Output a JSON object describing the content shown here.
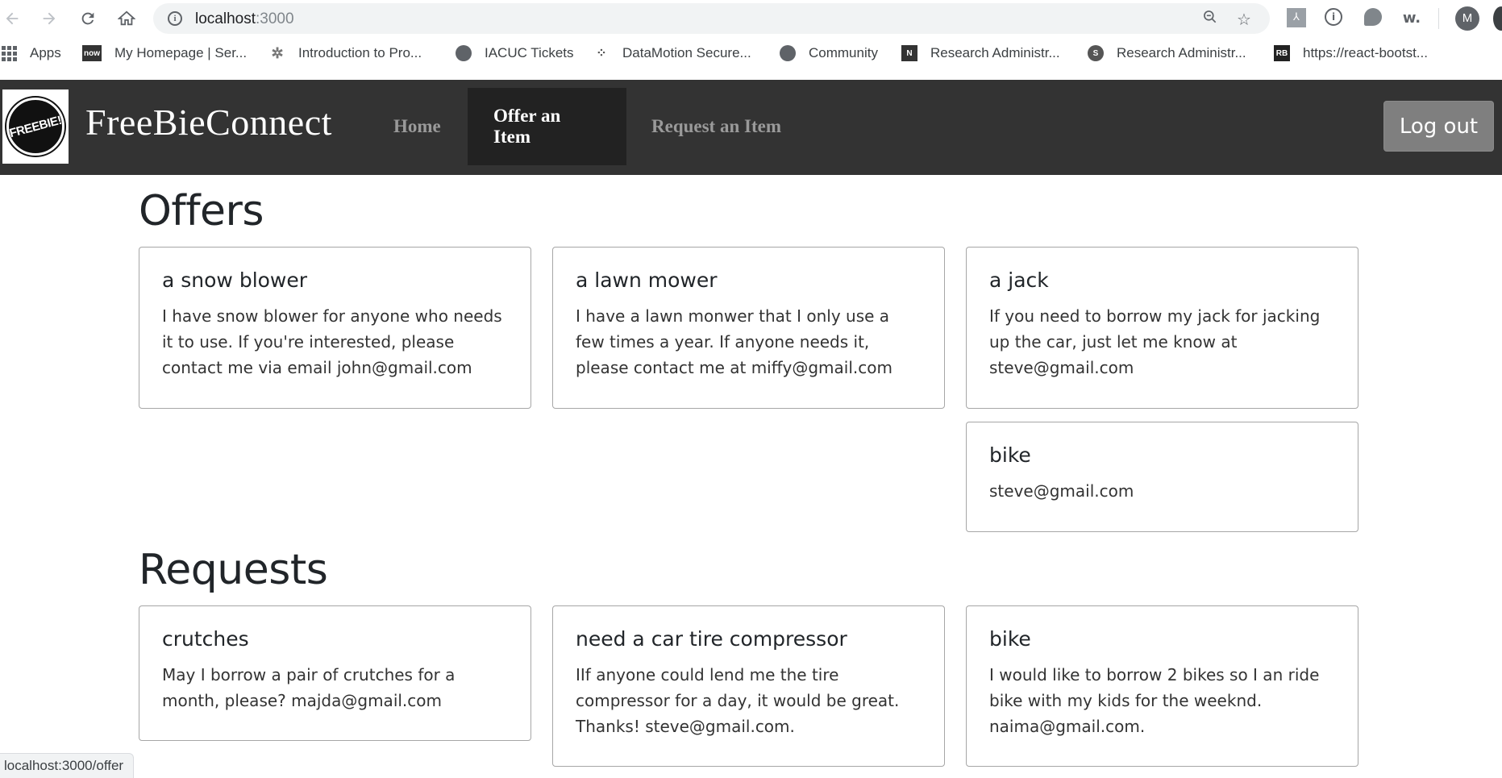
{
  "browser": {
    "url_host": "localhost",
    "url_port": ":3000",
    "avatar_initial": "M",
    "status_url": "localhost:3000/offer",
    "bookmarks": [
      {
        "label": "Apps",
        "icon": "apps-grid-icon"
      },
      {
        "label": "My Homepage | Ser...",
        "icon": "now-icon"
      },
      {
        "label": "Introduction to Pro...",
        "icon": "compass-icon"
      },
      {
        "label": "IACUC Tickets",
        "icon": "globe-icon"
      },
      {
        "label": "DataMotion Secure...",
        "icon": "dots-icon"
      },
      {
        "label": "Community",
        "icon": "globe-icon"
      },
      {
        "label": "Research Administr...",
        "icon": "onenote-icon"
      },
      {
        "label": "Research Administr...",
        "icon": "sharepoint-icon"
      },
      {
        "label": "https://react-bootst...",
        "icon": "react-bootstrap-icon"
      }
    ]
  },
  "navbar": {
    "logo_text": "FREEBIE!",
    "brand": "FreeBieConnect",
    "links": [
      {
        "label": "Home",
        "active": false
      },
      {
        "label": "Offer an Item",
        "active": true
      },
      {
        "label": "Request an Item",
        "active": false
      }
    ],
    "logout_label": "Log out"
  },
  "offers": {
    "title": "Offers",
    "items": [
      {
        "title": "a snow blower",
        "text": "I have snow blower for anyone who needs it to use. If you're interested, please contact me via email john@gmail.com"
      },
      {
        "title": "a lawn mower",
        "text": "I have a lawn monwer that I only use a few times a year. If anyone needs it, please contact me at miffy@gmail.com"
      },
      {
        "title": "a jack",
        "text": "If you need to borrow my jack for jacking up the car, just let me know at steve@gmail.com"
      },
      {
        "title": "bike",
        "text": "steve@gmail.com"
      }
    ]
  },
  "requests": {
    "title": "Requests",
    "items": [
      {
        "title": "crutches",
        "text": "May I borrow a pair of crutches for a month, please? majda@gmail.com"
      },
      {
        "title": "need a car tire compressor",
        "text": "IIf anyone could lend me the tire compressor for a day, it would be great. Thanks! steve@gmail.com."
      },
      {
        "title": "bike",
        "text": "I would like to borrow 2 bikes so I an ride bike with my kids for the weeknd. naima@gmail.com."
      }
    ]
  }
}
